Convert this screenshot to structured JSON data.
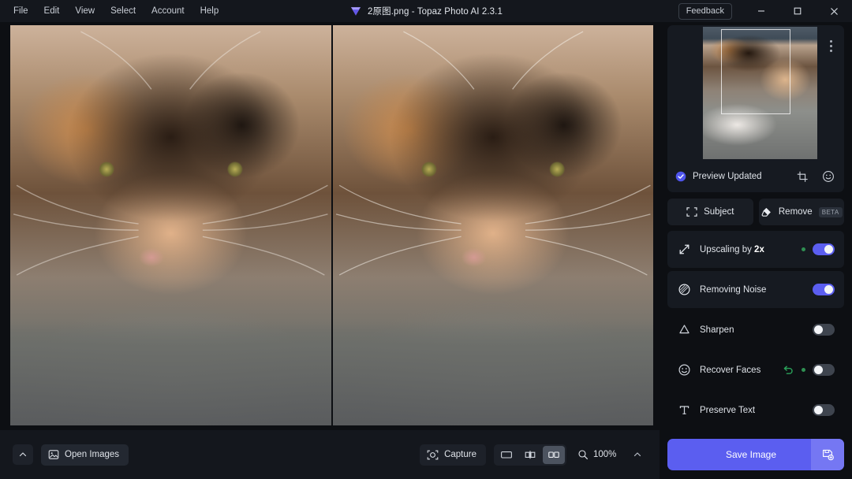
{
  "window": {
    "title": "2原图.png - Topaz Photo AI 2.3.1",
    "logo_icon": "topaz-gem-icon",
    "feedback_label": "Feedback",
    "minimize_icon": "minimize-icon",
    "maximize_icon": "maximize-icon",
    "close_icon": "close-icon"
  },
  "menu": {
    "items": [
      {
        "label": "File"
      },
      {
        "label": "Edit"
      },
      {
        "label": "View"
      },
      {
        "label": "Select"
      },
      {
        "label": "Account"
      },
      {
        "label": "Help"
      }
    ]
  },
  "viewer": {
    "left_pane_name": "original-image-pane",
    "right_pane_name": "preview-image-pane"
  },
  "bottom_bar": {
    "collapse_icon": "chevron-up-icon",
    "open_images_label": "Open Images",
    "open_images_icon": "image-icon",
    "capture_label": "Capture",
    "capture_icon": "capture-icon",
    "view_modes": [
      {
        "name": "single-view",
        "icon": "single-pane-icon",
        "active": false
      },
      {
        "name": "split-view",
        "icon": "split-pane-icon",
        "active": false
      },
      {
        "name": "side-by-side-view",
        "icon": "two-pane-icon",
        "active": true
      }
    ],
    "zoom_icon": "magnifier-icon",
    "zoom_level": "100%",
    "zoom_expand_icon": "chevron-up-icon"
  },
  "sidebar": {
    "thumbnail": {
      "menu_icon": "more-vertical-icon",
      "status_icon": "check-circle-icon",
      "status_text": "Preview Updated",
      "actions": [
        {
          "name": "crop-icon"
        },
        {
          "name": "face-icon"
        }
      ]
    },
    "tools": [
      {
        "name": "subject-button",
        "label": "Subject",
        "icon": "subject-brackets-icon",
        "badge": ""
      },
      {
        "name": "remove-button",
        "label": "Remove",
        "icon": "eraser-icon",
        "badge": "BETA"
      }
    ],
    "enhancements": [
      {
        "name": "upscaling",
        "label": "Upscaling by ",
        "strong": "2x",
        "icon": "upscale-arrow-icon",
        "enabled": true,
        "dot": true,
        "undo": false
      },
      {
        "name": "removing-noise",
        "label": "Removing Noise",
        "strong": "",
        "icon": "denoise-icon",
        "enabled": true,
        "dot": false,
        "undo": false
      },
      {
        "name": "sharpen",
        "label": "Sharpen",
        "strong": "",
        "icon": "sharpen-triangle-icon",
        "enabled": false,
        "dot": false,
        "undo": false
      },
      {
        "name": "recover-faces",
        "label": "Recover Faces",
        "strong": "",
        "icon": "face-circle-icon",
        "enabled": false,
        "dot": true,
        "undo": true
      },
      {
        "name": "preserve-text",
        "label": "Preserve Text",
        "strong": "",
        "icon": "text-t-icon",
        "enabled": false,
        "dot": false,
        "undo": false
      }
    ],
    "save": {
      "label": "Save Image",
      "options_icon": "save-settings-icon"
    }
  },
  "colors": {
    "accent": "#5b5ef0",
    "toggle_off": "#3e444e",
    "panel": "#161a21",
    "background": "#0d0f13",
    "titlebar": "#14171d",
    "green": "#2f8f52"
  }
}
